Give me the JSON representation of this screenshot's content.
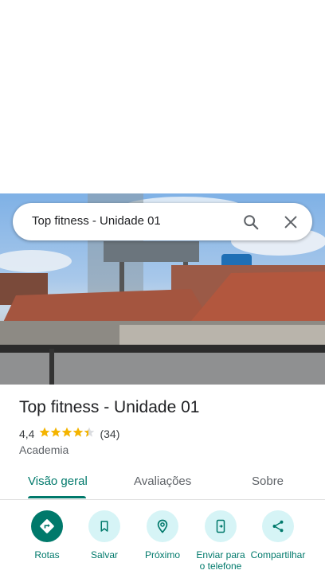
{
  "search": {
    "query": "Top fitness - Unidade 01"
  },
  "place": {
    "name": "Top fitness - Unidade 01",
    "rating": "4,4",
    "rating_stars": 4.4,
    "review_count": "(34)",
    "category": "Academia"
  },
  "tabs": [
    {
      "label": "Visão geral"
    },
    {
      "label": "Avaliações"
    },
    {
      "label": "Sobre"
    }
  ],
  "actions": [
    {
      "label": "Rotas",
      "icon": "directions-icon"
    },
    {
      "label": "Salvar",
      "icon": "bookmark-icon"
    },
    {
      "label": "Próximo",
      "icon": "nearby-icon"
    },
    {
      "label": "Enviar para o telefone",
      "icon": "send-to-phone-icon"
    },
    {
      "label": "Compartilhar",
      "icon": "share-icon"
    }
  ],
  "colors": {
    "accent": "#00796b",
    "action_bg": "#d6f4f6",
    "star": "#f4b400"
  }
}
